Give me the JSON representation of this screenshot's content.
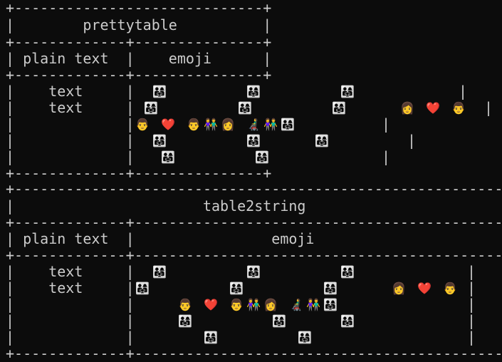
{
  "terminal": {
    "table1": {
      "border_top": "+-----------------------------+",
      "title_row": "|        prettytable          |",
      "border_sep": "+-------------+---------------+",
      "header_row": "| plain text  |    emoji      |",
      "rows_left": [
        "|    text     |",
        "|    text     |",
        "|             |",
        "|             |",
        "|             |"
      ],
      "border_bottom": "+-------------+---------------+"
    },
    "table2": {
      "border_top": "+---------------------------------------------------------+",
      "title_row": "|                      table2string                       |",
      "border_sep": "+-------------+-------------------------------------------+",
      "header_row": "| plain text  |                emoji                      |",
      "rows_left": [
        "|    text     |",
        "|    text     |",
        "|             |",
        "|             |",
        "|             |"
      ],
      "border_bottom": "+-------------+-------------------------------------------+"
    },
    "emoji": {
      "family": "👨‍👩‍👧",
      "man": "👨",
      "woman": "👩",
      "heart": "❤️",
      "people": "👫",
      "wheelchair": "👨‍🦼",
      "bar": "|"
    }
  }
}
